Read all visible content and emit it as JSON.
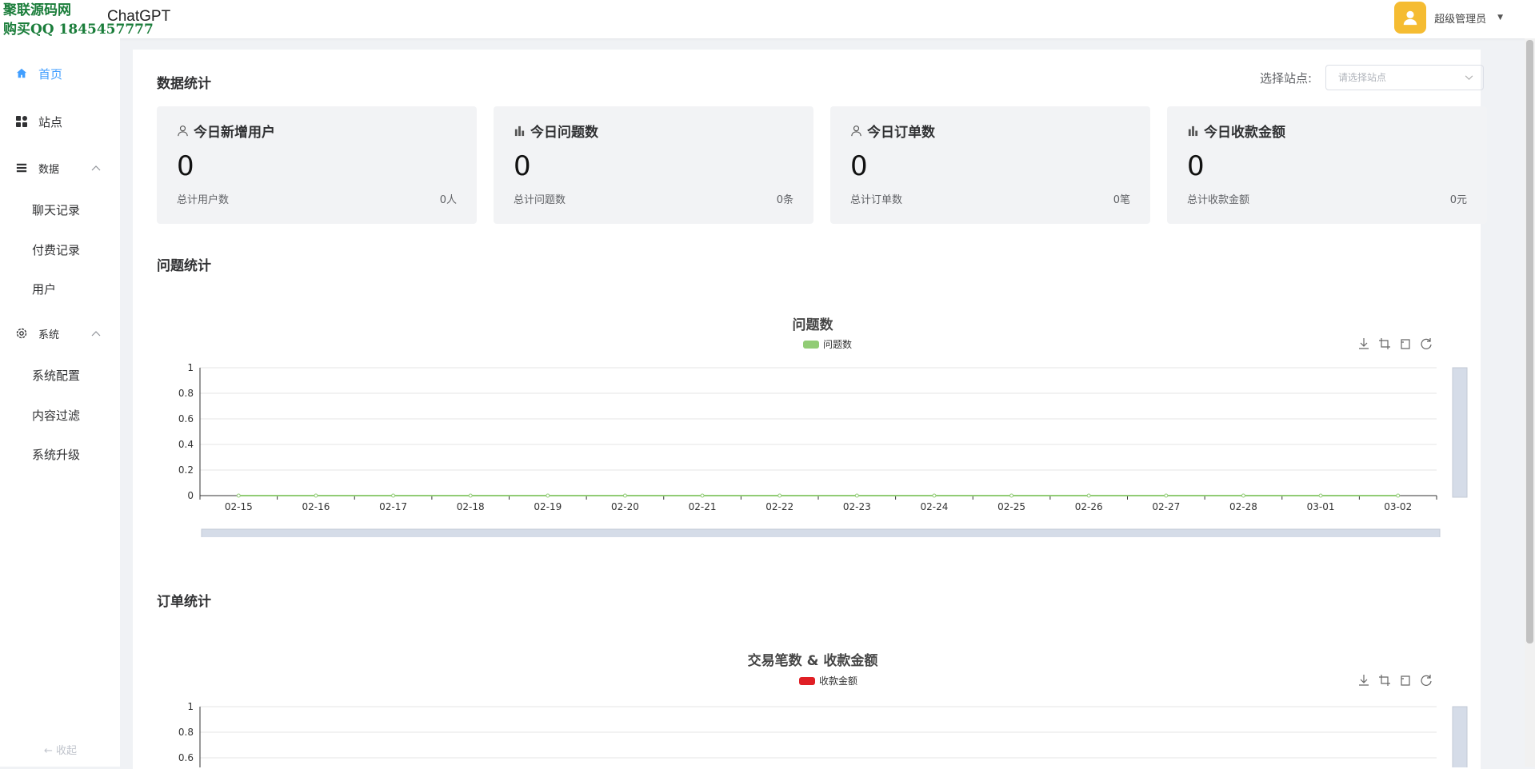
{
  "watermark": {
    "line1": "聚联源码网",
    "line2": "购买QQ 1845457777"
  },
  "app": {
    "brand": "ChatGPT",
    "user_name": "超级管理员"
  },
  "sidebar": {
    "home": "首页",
    "site": "站点",
    "data": "数据",
    "data_items": [
      "聊天记录",
      "付费记录",
      "用户"
    ],
    "system": "系统",
    "system_items": [
      "系统配置",
      "内容过滤",
      "系统升级"
    ],
    "collapse": "← 收起"
  },
  "page": {
    "title": "数据统计",
    "site_label": "选择站点:",
    "site_placeholder": "请选择站点"
  },
  "stats": [
    {
      "title": "今日新增用户",
      "icon": "user-icon",
      "value": "0",
      "foot_label": "总计用户数",
      "foot_value": "0人"
    },
    {
      "title": "今日问题数",
      "icon": "bar-chart-icon",
      "value": "0",
      "foot_label": "总计问题数",
      "foot_value": "0条"
    },
    {
      "title": "今日订单数",
      "icon": "user-icon",
      "value": "0",
      "foot_label": "总计订单数",
      "foot_value": "0笔"
    },
    {
      "title": "今日收款金额",
      "icon": "bar-chart-icon",
      "value": "0",
      "foot_label": "总计收款金额",
      "foot_value": "0元"
    }
  ],
  "sections": {
    "questions": "问题统计",
    "orders": "订单统计"
  },
  "colors": {
    "accent": "#409eff",
    "series_green": "#91cc75",
    "series_red": "#e01f25",
    "avatar": "#f5bc32"
  },
  "chart_data": [
    {
      "type": "line",
      "title": "问题数",
      "categories": [
        "02-15",
        "02-16",
        "02-17",
        "02-18",
        "02-19",
        "02-20",
        "02-21",
        "02-22",
        "02-23",
        "02-24",
        "02-25",
        "02-26",
        "02-27",
        "02-28",
        "03-01",
        "03-02"
      ],
      "series": [
        {
          "name": "问题数",
          "values": [
            0,
            0,
            0,
            0,
            0,
            0,
            0,
            0,
            0,
            0,
            0,
            0,
            0,
            0,
            0,
            0
          ]
        }
      ],
      "ylim": [
        0,
        1
      ],
      "yticks": [
        "0",
        "0.2",
        "0.4",
        "0.6",
        "0.8",
        "1"
      ],
      "grid": true,
      "legend": "top-center"
    },
    {
      "type": "line",
      "title": "交易笔数 & 收款金额",
      "categories": [],
      "series": [
        {
          "name": "收款金额",
          "values": []
        }
      ],
      "ylim": [
        0,
        1
      ],
      "yticks": [
        "0.6",
        "0.8",
        "1"
      ],
      "grid": true,
      "legend": "top-center"
    }
  ]
}
